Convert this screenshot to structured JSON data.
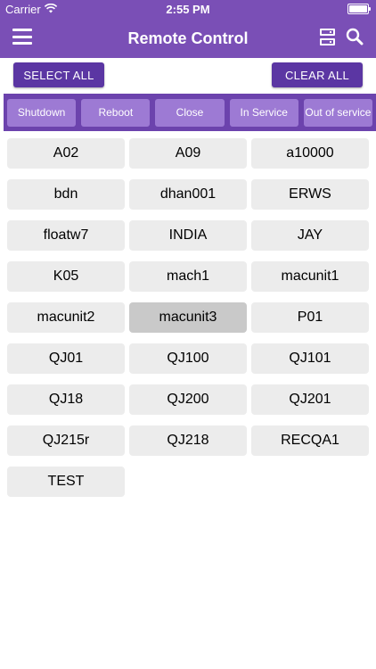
{
  "status_bar": {
    "carrier": "Carrier",
    "time": "2:55 PM"
  },
  "nav": {
    "title": "Remote Control",
    "menu_icon": "menu-icon",
    "server_icon": "server-icon",
    "search_icon": "search-icon"
  },
  "selection": {
    "select_all_label": "SELECT ALL",
    "clear_all_label": "CLEAR ALL"
  },
  "actions": [
    {
      "label": "Shutdown"
    },
    {
      "label": "Reboot"
    },
    {
      "label": "Close"
    },
    {
      "label": "In Service"
    },
    {
      "label": "Out of service"
    }
  ],
  "units": [
    {
      "name": "A02",
      "selected": false
    },
    {
      "name": "A09",
      "selected": false
    },
    {
      "name": "a10000",
      "selected": false
    },
    {
      "name": "bdn",
      "selected": false
    },
    {
      "name": "dhan001",
      "selected": false
    },
    {
      "name": "ERWS",
      "selected": false
    },
    {
      "name": "floatw7",
      "selected": false
    },
    {
      "name": "INDIA",
      "selected": false
    },
    {
      "name": "JAY",
      "selected": false
    },
    {
      "name": "K05",
      "selected": false
    },
    {
      "name": "mach1",
      "selected": false
    },
    {
      "name": "macunit1",
      "selected": false
    },
    {
      "name": "macunit2",
      "selected": false
    },
    {
      "name": "macunit3",
      "selected": true
    },
    {
      "name": "P01",
      "selected": false
    },
    {
      "name": "QJ01",
      "selected": false
    },
    {
      "name": "QJ100",
      "selected": false
    },
    {
      "name": "QJ101",
      "selected": false
    },
    {
      "name": "QJ18",
      "selected": false
    },
    {
      "name": "QJ200",
      "selected": false
    },
    {
      "name": "QJ201",
      "selected": false
    },
    {
      "name": "QJ215r",
      "selected": false
    },
    {
      "name": "QJ218",
      "selected": false
    },
    {
      "name": "RECQA1",
      "selected": false
    },
    {
      "name": "TEST",
      "selected": false
    }
  ],
  "colors": {
    "nav": "#7a4fb6",
    "button": "#5b36a3",
    "action_bar": "#6c43ad",
    "action_button": "#9d7ad4",
    "cell": "#ececec",
    "cell_selected": "#c9c9c9"
  }
}
